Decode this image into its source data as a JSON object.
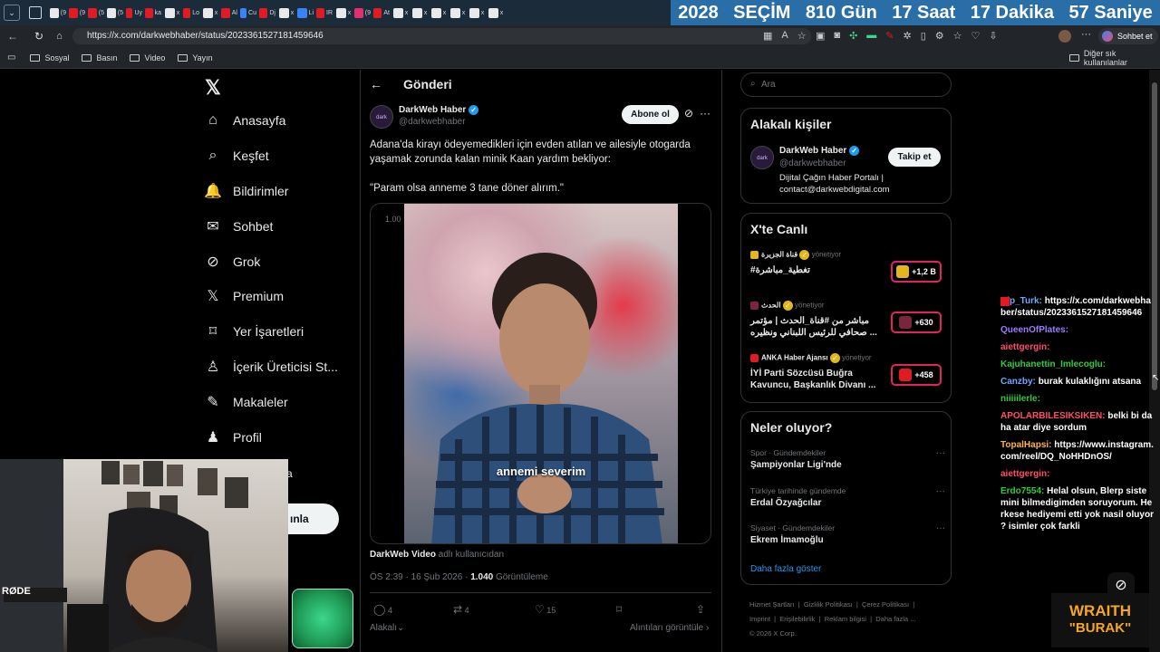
{
  "browser": {
    "tabs": [
      "(9",
      "(9",
      "(5",
      "(5",
      "Uy",
      "ka",
      "x",
      "Lo",
      "x",
      "Al",
      "Cu",
      "Dj",
      "x",
      "Li",
      "IR",
      "x",
      "(9",
      "At",
      "x",
      "x",
      "x",
      "x",
      "x",
      "x"
    ],
    "countdown": {
      "year_label": "2028",
      "event_label": "SEÇİM",
      "days": "810 Gün",
      "hours": "17 Saat",
      "minutes": "17 Dakika",
      "seconds": "57 Saniye"
    },
    "url": "https://x.com/darkwebhaber/status/2023361527181459646",
    "chat_button": "Sohbet et",
    "bookmarks": [
      "Sosyal",
      "Basın",
      "Video",
      "Yayın"
    ],
    "other_bookmarks": "Diğer sık kullanılanlar"
  },
  "sidebar": {
    "items": [
      {
        "label": "Anasayfa",
        "icon": "home-icon"
      },
      {
        "label": "Keşfet",
        "icon": "search-icon"
      },
      {
        "label": "Bildirimler",
        "icon": "bell-icon"
      },
      {
        "label": "Sohbet",
        "icon": "mail-icon"
      },
      {
        "label": "Grok",
        "icon": "grok-icon"
      },
      {
        "label": "Premium",
        "icon": "x-icon"
      },
      {
        "label": "Yer İşaretleri",
        "icon": "bookmark-icon"
      },
      {
        "label": "İçerik Üreticisi St...",
        "icon": "creator-icon"
      },
      {
        "label": "Makaleler",
        "icon": "article-icon"
      },
      {
        "label": "Profil",
        "icon": "profile-icon"
      }
    ],
    "post_button_fragment": "ınla",
    "more_fragment": "a"
  },
  "post": {
    "header_title": "Gönderi",
    "author_name": "DarkWeb Haber",
    "author_handle": "@darkwebhaber",
    "subscribe_label": "Abone ol",
    "text_line1": "Adana'da kirayı ödeyemedikleri için evden atılan ve ailesiyle otogarda yaşamak zorunda kalan minik Kaan yardım bekliyor:",
    "text_line2": "\"Param olsa anneme 3 tane döner alırım.\"",
    "video_time": "1.00",
    "video_caption": "annemi severim",
    "source_name": "DarkWeb Video",
    "source_suffix": "adlı kullanıcıdan",
    "timestamp": "ÖS 2:39 · 16 Şub 2026 · ",
    "views_count": "1.040",
    "views_label": "Görüntüleme",
    "replies": "4",
    "reposts": "4",
    "likes": "15",
    "related_label": "Alakalı",
    "quotes_label": "Alıntıları görüntüle"
  },
  "aside": {
    "search_placeholder": "Ara",
    "related_people_title": "Alakalı kişiler",
    "person": {
      "name": "DarkWeb Haber",
      "handle": "@darkwebhaber",
      "bio": "Dijital Çağın Haber Portalı | contact@darkwebdigital.com",
      "follow_label": "Takip et"
    },
    "live_title": "X'te Canlı",
    "live": [
      {
        "host": "قناة الجزيرة",
        "role": "yönetiyor",
        "title": "#تغطية_مباشرة",
        "count": "+1,2 B"
      },
      {
        "host": "الحدث",
        "role": "yönetiyor",
        "title": "مباشر من #قناة_الحدث | مؤتمر صحافي للرئيس اللبناني ونظيره ...",
        "count": "+630"
      },
      {
        "host": "ANKA Haber Ajansı",
        "role": "yönetiyor",
        "title": "İYİ Parti Sözcüsü Buğra Kavuncu, Başkanlık Divanı ...",
        "count": "+458"
      }
    ],
    "trends_title": "Neler oluyor?",
    "trends": [
      {
        "context": "Spor · Gündemdekiler",
        "title": "Şampiyonlar Ligi'nde"
      },
      {
        "context": "Türkiye tarihinde gündemde",
        "title": "Erdal Özyağcılar"
      },
      {
        "context": "Siyaset · Gündemdekiler",
        "title": "Ekrem İmamoğlu"
      }
    ],
    "show_more": "Daha fazla göster",
    "footer": {
      "terms": "Hizmet Şartları",
      "privacy": "Gizlilik Politikası",
      "cookies": "Çerez Politikası",
      "imprint": "Imprint",
      "accessibility": "Erişilebilirlik",
      "ads": "Reklam bilgisi",
      "more": "Daha fazla ...",
      "copyright": "© 2026 X Corp."
    }
  },
  "chat": {
    "messages": [
      {
        "user": "Alp_Turk:",
        "text": "https://x.com/darkwebhaber/status/2023361527181459646",
        "color": "#6ea8ff"
      },
      {
        "user": "QueenOfPlates:",
        "text": "",
        "color": "#9b7bff"
      },
      {
        "user": "aiettgergin:",
        "text": "",
        "color": "#ff4d6d"
      },
      {
        "user": "Kajuhanettin_Imlecoglu:",
        "text": "",
        "color": "#2ecc40"
      },
      {
        "user": "Canzby:",
        "text": "burak kulaklığını atsana",
        "color": "#6ea8ff"
      },
      {
        "user": "niiiiilerle:",
        "text": "",
        "color": "#2ecc40"
      },
      {
        "user": "APOLARBILESIKSIKEN:",
        "text": "belki bi daha atar diye sordum",
        "color": "#ff4d6d"
      },
      {
        "user": "TopalHapsi:",
        "text": "https://www.instagram.com/reel/DQ_NoHHDnOS/",
        "color": "#ffb347"
      },
      {
        "user": "aiettgergin:",
        "text": "",
        "color": "#ff4d6d"
      },
      {
        "user": "Erdo7554:",
        "text": "Helal olsun, Blerp sistemini bilmedigimden soruyorum. Herkese hediyemi etti yok nasil oluyor ? isimler çok farkli",
        "color": "#2ecc40"
      }
    ]
  },
  "overlay": {
    "mic_label": "RØDE",
    "brand_top": "WRAITH",
    "brand_bottom": "\"BURAK\""
  }
}
